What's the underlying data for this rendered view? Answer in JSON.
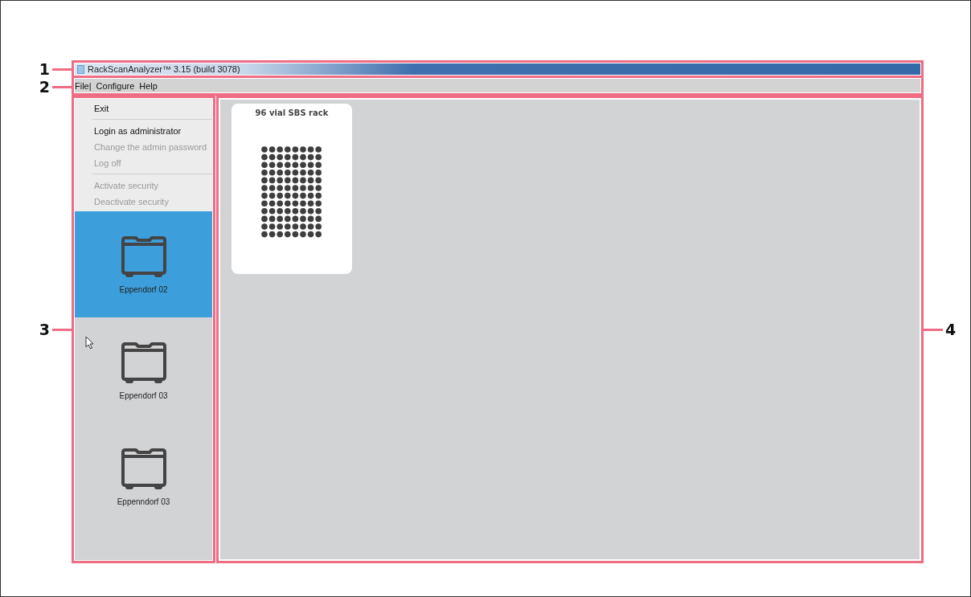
{
  "callouts": [
    "1",
    "2",
    "3",
    "4"
  ],
  "window": {
    "title": "RackScanAnalyzer™ 3.15 (build 3078)"
  },
  "menu_bar": [
    {
      "label": "File|"
    },
    {
      "label": "Configure"
    },
    {
      "label": "Help"
    }
  ],
  "file_menu": [
    {
      "kind": "item",
      "label": "Exit",
      "disabled": false
    },
    {
      "kind": "separator"
    },
    {
      "kind": "item",
      "label": "Login as administrator",
      "disabled": false
    },
    {
      "kind": "item",
      "label": "Change the admin password",
      "disabled": true
    },
    {
      "kind": "item",
      "label": "Log off",
      "disabled": true
    },
    {
      "kind": "separator"
    },
    {
      "kind": "item",
      "label": "Activate security",
      "disabled": true
    },
    {
      "kind": "item",
      "label": "Deactivate security",
      "disabled": true
    }
  ],
  "devices": [
    {
      "name": "Eppendorf 02",
      "selected": true
    },
    {
      "name": "Eppendorf 03",
      "selected": false
    },
    {
      "name": "Eppenndorf 03",
      "selected": false
    }
  ],
  "racks": [
    {
      "title": "96 vial SBS rack"
    }
  ]
}
